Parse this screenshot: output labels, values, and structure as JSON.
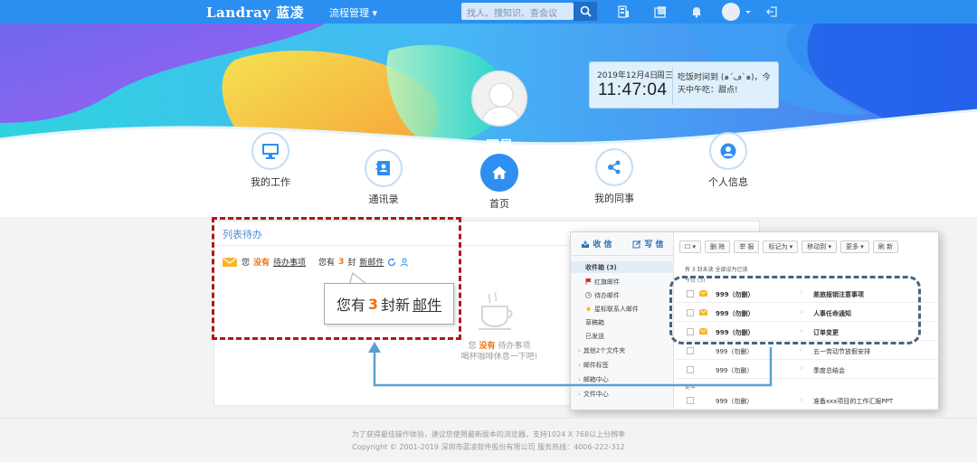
{
  "topbar": {
    "logo": "Landray 蓝凌",
    "process_menu": "流程管理 ▾",
    "search_placeholder": "找人、搜知识、查会议"
  },
  "hero": {
    "user_name": "网易"
  },
  "clock": {
    "date": "2019年12月4日",
    "weekday": "周三",
    "time": "11:47:04",
    "message": "吃饭时间到 (๑´ڡ`๑)，今天中午吃：甜点!"
  },
  "nav": [
    {
      "label": "我的工作",
      "icon": "monitor-icon"
    },
    {
      "label": "通讯录",
      "icon": "address-book-icon"
    },
    {
      "label": "首页",
      "icon": "home-icon"
    },
    {
      "label": "我的同事",
      "icon": "share-nodes-icon"
    },
    {
      "label": "个人信息",
      "icon": "user-icon"
    }
  ],
  "todo": {
    "panel_title": "列表待办",
    "you_have": "您",
    "none": "没有",
    "todo_link": "待办事项",
    "you_have_mail": "您有",
    "mail_count": "3",
    "mail_unit": "封",
    "mail_link": "新邮件",
    "empty_none_prefix": "您",
    "empty_none": "没有",
    "empty_todo": "待办事项",
    "empty_rest": "喝杯咖啡休息一下吧!"
  },
  "callout": {
    "prefix": "您有",
    "count": "3",
    "unit": "封新",
    "link": "邮件"
  },
  "mail": {
    "tab_receive": "收 信",
    "tab_compose": "写 信",
    "folders": [
      {
        "label": "收件箱 (3)",
        "selected": true
      },
      {
        "label": "红旗邮件"
      },
      {
        "label": "待办邮件"
      },
      {
        "label": "星标联系人邮件"
      },
      {
        "label": "草稿箱"
      },
      {
        "label": "已发送"
      },
      {
        "label": "其他2个文件夹"
      },
      {
        "label": "邮件标签"
      },
      {
        "label": "邮箱中心"
      },
      {
        "label": "文件中心"
      }
    ],
    "toolbar": [
      "删 除",
      "举 报",
      "标记为 ▾",
      "移动到 ▾",
      "更多 ▾",
      "刷 新"
    ],
    "summary": "有 3 封未读  全部设为已读",
    "group_today": "今日 (3)",
    "group_earlier": "更早",
    "rows": [
      {
        "from": "999（勿删）",
        "subject": "差旅报销注意事项",
        "unread": true
      },
      {
        "from": "999（勿删）",
        "subject": "人事任命通知",
        "unread": true
      },
      {
        "from": "999（勿删）",
        "subject": "订单变更",
        "unread": true
      },
      {
        "from": "999（勿删）",
        "subject": "五一劳动节放假安排",
        "unread": false
      },
      {
        "from": "999（勿删）",
        "subject": "季度总结会",
        "unread": false
      },
      {
        "from": "999（勿删）",
        "subject": "准备xxx项目的工作汇报PPT",
        "unread": false
      }
    ]
  },
  "footer": {
    "line1": "为了获得最佳操作体验，建议您使用最新版本的浏览器，支持1024 X 768以上分辨率",
    "line2": "Copyright © 2001-2019 深圳市蓝凌软件股份有限公司 服务热线：4006-222-312"
  },
  "colors": {
    "topbar": "#2a8ff0",
    "accent_orange": "#f07010",
    "dash_red": "#b01818",
    "dash_slate": "#46637e"
  }
}
